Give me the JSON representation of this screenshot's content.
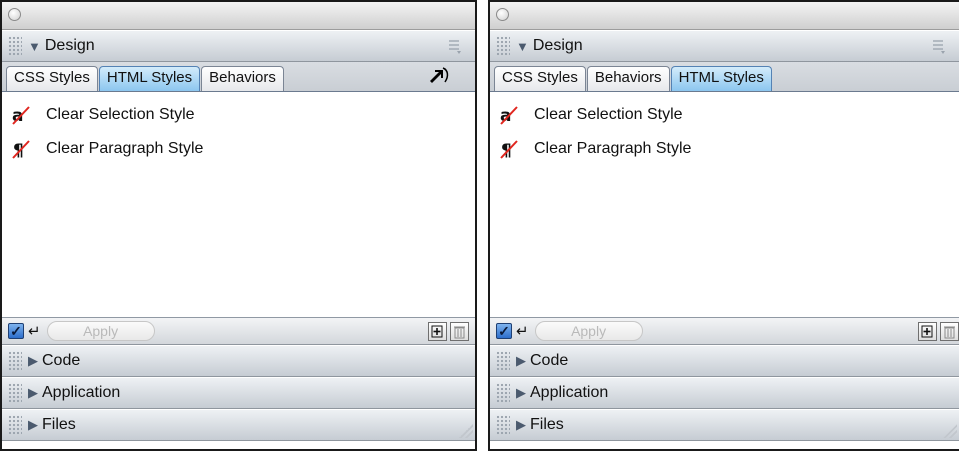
{
  "panels": [
    {
      "design": {
        "title": "Design",
        "tabs": [
          {
            "label": "CSS Styles",
            "active": false
          },
          {
            "label": "HTML Styles",
            "active": true
          },
          {
            "label": "Behaviors",
            "active": false
          }
        ]
      },
      "list": [
        {
          "label": "Clear Selection Style",
          "icon": "clear-selection-style-icon"
        },
        {
          "label": "Clear Paragraph Style",
          "icon": "clear-paragraph-style-icon"
        }
      ],
      "toolbar": {
        "apply_label": "Apply"
      },
      "collapsed_sections": [
        "Code",
        "Application",
        "Files"
      ]
    },
    {
      "design": {
        "title": "Design",
        "tabs": [
          {
            "label": "CSS Styles",
            "active": false
          },
          {
            "label": "Behaviors",
            "active": false
          },
          {
            "label": "HTML Styles",
            "active": true
          }
        ]
      },
      "list": [
        {
          "label": "Clear Selection Style",
          "icon": "clear-selection-style-icon"
        },
        {
          "label": "Clear Paragraph Style",
          "icon": "clear-paragraph-style-icon"
        }
      ],
      "toolbar": {
        "apply_label": "Apply"
      },
      "collapsed_sections": [
        "Code",
        "Application",
        "Files"
      ]
    }
  ],
  "colors": {
    "active_tab": "#8cc6ef",
    "icon_strike": "#e0261f"
  }
}
